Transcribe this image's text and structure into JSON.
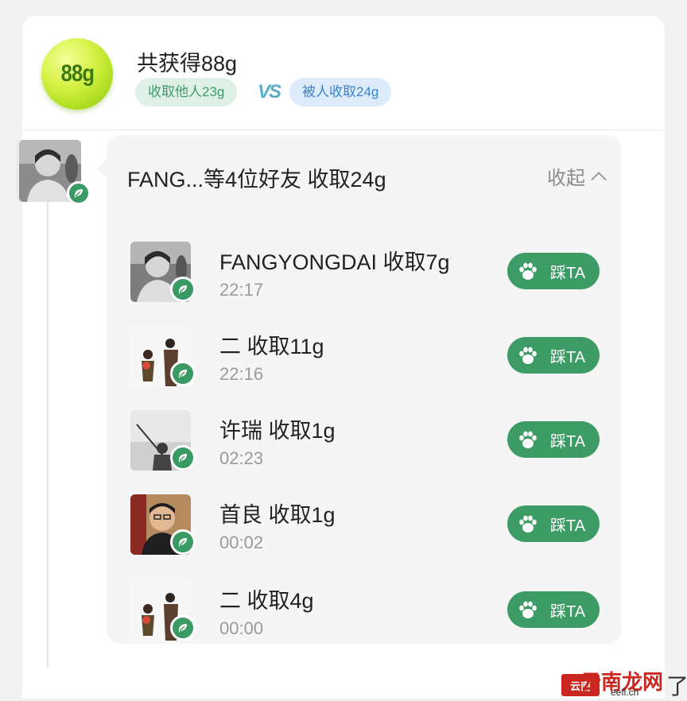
{
  "header": {
    "energy_value": "88g",
    "total_title": "共获得88g",
    "collected_chip": "收取他人23g",
    "vs_label": "VS",
    "stolen_chip": "被人收取24g"
  },
  "panel": {
    "title": "FANG...等4位好友 收取24g",
    "collapse_label": "收起"
  },
  "friends": [
    {
      "name": "FANGYONGDAI 收取7g",
      "time": "22:17",
      "button": "踩TA"
    },
    {
      "name": "二 收取11g",
      "time": "22:16",
      "button": "踩TA"
    },
    {
      "name": "许瑞 收取1g",
      "time": "02:23",
      "button": "踩TA"
    },
    {
      "name": "首良 收取1g",
      "time": "00:02",
      "button": "踩TA"
    },
    {
      "name": "二 收取4g",
      "time": "00:00",
      "button": "踩TA"
    }
  ],
  "watermark": {
    "logo_text": "云南",
    "name": "云南龙网",
    "url": "eefl.cn",
    "tail": "了"
  },
  "colors": {
    "accent_green": "#3d9b66",
    "energy_ball": "#c8ec35",
    "collected_chip_bg": "#dff1e6",
    "stolen_chip_bg": "#dcecfb"
  },
  "icons": {
    "badge": "leaf-hand-icon",
    "step_button": "paw-icon",
    "collapse": "chevron-up-icon"
  }
}
